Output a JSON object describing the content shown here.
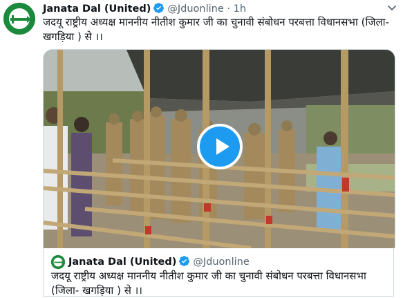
{
  "tweet": {
    "display_name": "Janata Dal (United)",
    "handle": "@Jduonline",
    "separator": "·",
    "time": "1h",
    "text": "जदयू राष्ट्रीय अध्यक्ष माननीय नीतीश कुमार जी का चुनावी संबोधन परबत्ता विधानसभा (जिला- खगड़िया ) से ।।",
    "verified_icon": "verified-badge-icon",
    "more_icon": "chevron-down-icon"
  },
  "media": {
    "type": "video",
    "play_icon": "play-icon"
  },
  "quoted_tweet": {
    "display_name": "Janata Dal (United)",
    "handle": "@Jduonline",
    "text": "जदयू राष्ट्रीय अध्यक्ष माननीय नीतीश कुमार जी का चुनावी संबोधन परबत्ता विधानसभा (जिला- खगड़िया ) से ।।"
  },
  "colors": {
    "accent": "#1d9bf0",
    "text_primary": "#0f1419",
    "text_secondary": "#536471",
    "brand_green": "#1b8a3c"
  }
}
